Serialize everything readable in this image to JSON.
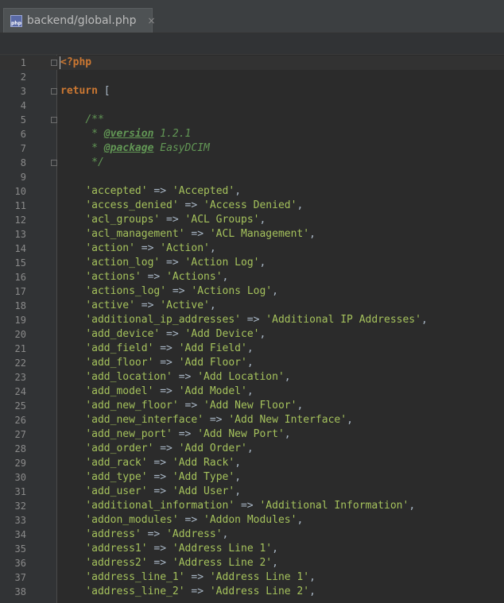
{
  "tab": {
    "title": "backend/global.php",
    "close_glyph": "×",
    "icon_label": "php"
  },
  "code": {
    "php_open": "<?php",
    "return_kw": "return",
    "return_rest": " [",
    "doc_open": "/**",
    "version_tag": "@version",
    "version_value": " 1.2.1",
    "package_tag": "@package",
    "package_value": " EasyDCIM",
    "doc_close": "*/",
    "entries": [
      {
        "key": "'accepted'",
        "value": "'Accepted'"
      },
      {
        "key": "'access_denied'",
        "value": "'Access Denied'"
      },
      {
        "key": "'acl_groups'",
        "value": "'ACL Groups'"
      },
      {
        "key": "'acl_management'",
        "value": "'ACL Management'"
      },
      {
        "key": "'action'",
        "value": "'Action'"
      },
      {
        "key": "'action_log'",
        "value": "'Action Log'"
      },
      {
        "key": "'actions'",
        "value": "'Actions'"
      },
      {
        "key": "'actions_log'",
        "value": "'Actions Log'"
      },
      {
        "key": "'active'",
        "value": "'Active'"
      },
      {
        "key": "'additional_ip_addresses'",
        "value": "'Additional IP Addresses'"
      },
      {
        "key": "'add_device'",
        "value": "'Add Device'"
      },
      {
        "key": "'add_field'",
        "value": "'Add Field'"
      },
      {
        "key": "'add_floor'",
        "value": "'Add Floor'"
      },
      {
        "key": "'add_location'",
        "value": "'Add Location'"
      },
      {
        "key": "'add_model'",
        "value": "'Add Model'"
      },
      {
        "key": "'add_new_floor'",
        "value": "'Add New Floor'"
      },
      {
        "key": "'add_new_interface'",
        "value": "'Add New Interface'"
      },
      {
        "key": "'add_new_port'",
        "value": "'Add New Port'"
      },
      {
        "key": "'add_order'",
        "value": "'Add Order'"
      },
      {
        "key": "'add_rack'",
        "value": "'Add Rack'"
      },
      {
        "key": "'add_type'",
        "value": "'Add Type'"
      },
      {
        "key": "'add_user'",
        "value": "'Add User'"
      },
      {
        "key": "'additional_information'",
        "value": "'Additional Information'"
      },
      {
        "key": "'addon_modules'",
        "value": "'Addon Modules'"
      },
      {
        "key": "'address'",
        "value": "'Address'"
      },
      {
        "key": "'address1'",
        "value": "'Address Line 1'"
      },
      {
        "key": "'address2'",
        "value": "'Address Line 2'"
      },
      {
        "key": "'address_line_1'",
        "value": "'Address Line 1'"
      },
      {
        "key": "'address_line_2'",
        "value": "'Address Line 2'"
      }
    ],
    "arrow": " => ",
    "comma": ","
  },
  "line_numbers": [
    "1",
    "2",
    "3",
    "4",
    "5",
    "6",
    "7",
    "8",
    "9",
    "10",
    "11",
    "12",
    "13",
    "14",
    "15",
    "16",
    "17",
    "18",
    "19",
    "20",
    "21",
    "22",
    "23",
    "24",
    "25",
    "26",
    "27",
    "28",
    "29",
    "30",
    "31",
    "32",
    "33",
    "34",
    "35",
    "36",
    "37",
    "38"
  ],
  "colors": {
    "background": "#2b2b2b",
    "keyword": "#cc7832",
    "string": "#a5c25c",
    "doc_comment": "#629755",
    "text": "#a9b7c6"
  }
}
